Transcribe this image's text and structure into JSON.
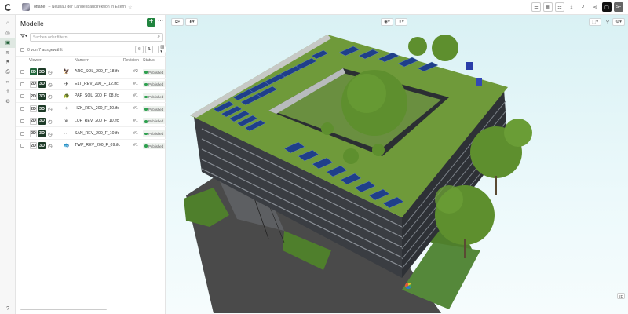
{
  "topbar": {
    "project_name": "ottane",
    "project_title": "– Neubau der Landesbaudirektion in Eltern",
    "star_icon": "star-icon",
    "buttons": [
      "list-icon",
      "grid-icon",
      "checklist-icon",
      "download-icon",
      "bell-icon",
      "share-icon",
      "frame-icon"
    ],
    "avatar": "SF"
  },
  "rail": {
    "items": [
      "home-icon",
      "location-icon",
      "models-icon",
      "layers-icon",
      "issues-icon",
      "print-icon",
      "link-icon",
      "upload-icon",
      "settings-icon"
    ],
    "active_index": 2,
    "help": "?"
  },
  "panel": {
    "title": "Modelle",
    "add_label": "+",
    "more_label": "⋯",
    "search_placeholder": "Suchen oder filtern...",
    "selection_text": "0 von 7 ausgewählt",
    "columns": {
      "viewer": "Viewer",
      "name": "Name ▾",
      "revision": "Revision",
      "status": "Status"
    },
    "rows": [
      {
        "name": "ARC_SOL_200_F_18.ifc",
        "revision": "#2",
        "status": "Published",
        "icon": "🦅",
        "color": "#333",
        "two_d_on": true
      },
      {
        "name": "ELT_REV_200_F_12.ifc",
        "revision": "#1",
        "status": "Published",
        "icon": "✈",
        "color": "#555",
        "two_d_on": false
      },
      {
        "name": "PAP_SOL_200_F_08.ifc",
        "revision": "#1",
        "status": "Published",
        "icon": "🐢",
        "color": "#6b8c2a",
        "two_d_on": false
      },
      {
        "name": "HZK_REV_200_F_10.ifc",
        "revision": "#1",
        "status": "Published",
        "icon": "✧",
        "color": "#888",
        "two_d_on": false
      },
      {
        "name": "LUF_REV_200_F_10.ifc",
        "revision": "#1",
        "status": "Published",
        "icon": "❦",
        "color": "#888",
        "two_d_on": false
      },
      {
        "name": "SAN_REV_200_F_10.ifc",
        "revision": "#1",
        "status": "Published",
        "icon": "⋯",
        "color": "#888",
        "two_d_on": false
      },
      {
        "name": "TWP_REV_200_F_09.ifc",
        "revision": "#1",
        "status": "Published",
        "icon": "🐟",
        "color": "#d4752c",
        "two_d_on": false
      }
    ]
  },
  "viewer": {
    "badge_2d": "2D",
    "left_tools": [
      "cube-icon",
      "pin-icon"
    ],
    "mid_tools": [
      "eye-icon",
      "section-icon"
    ],
    "right_tools": [
      "select-icon",
      "person-icon",
      "settings-icon"
    ],
    "colors": {
      "sky": "#dff3f6",
      "roof_green": "#6f9a3a",
      "solar": "#1f3f8a",
      "facade": "#3a3d42",
      "tree": "#5e8f2e"
    }
  }
}
